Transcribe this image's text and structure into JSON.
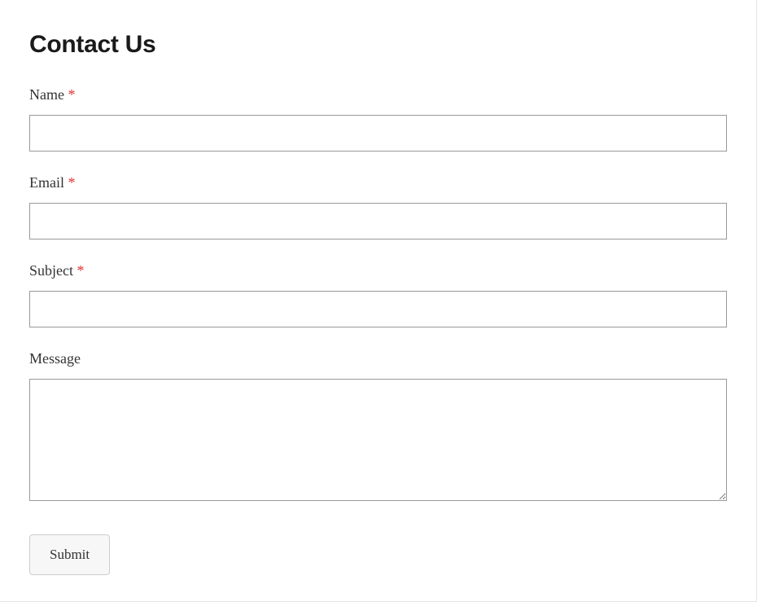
{
  "page": {
    "title": "Contact Us"
  },
  "form": {
    "fields": {
      "name": {
        "label": "Name",
        "required_marker": "*",
        "value": ""
      },
      "email": {
        "label": "Email",
        "required_marker": "*",
        "value": ""
      },
      "subject": {
        "label": "Subject",
        "required_marker": "*",
        "value": ""
      },
      "message": {
        "label": "Message",
        "value": ""
      }
    },
    "submit_label": "Submit"
  }
}
